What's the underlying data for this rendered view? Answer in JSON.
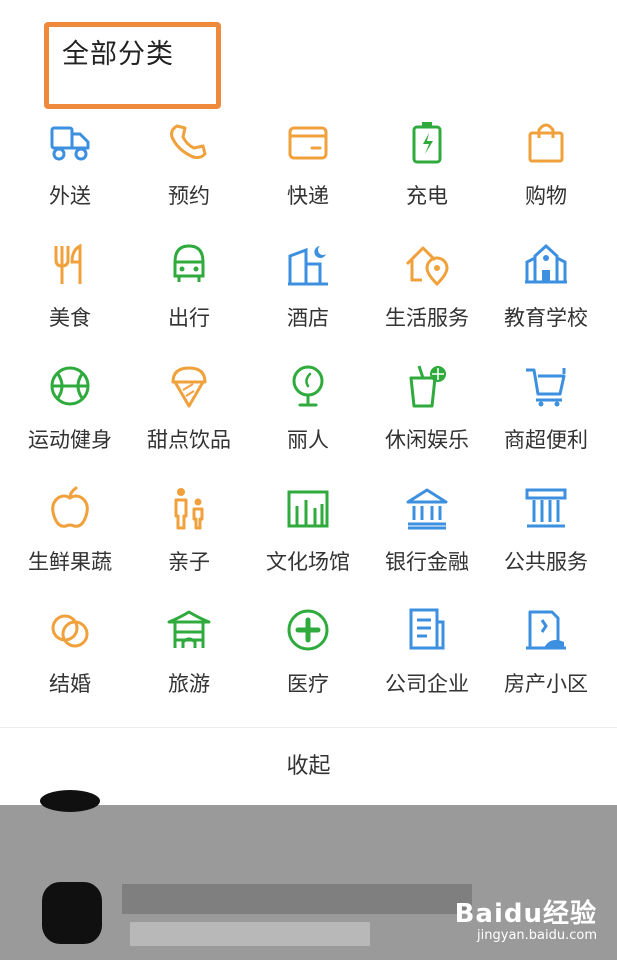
{
  "header": {
    "title": "全部分类"
  },
  "categories": [
    {
      "label": "外送",
      "icon": "truck-icon",
      "color": "#3d8fe0"
    },
    {
      "label": "预约",
      "icon": "phone-icon",
      "color": "#f0a13c"
    },
    {
      "label": "快递",
      "icon": "wallet-icon",
      "color": "#f0a13c"
    },
    {
      "label": "充电",
      "icon": "battery-icon",
      "color": "#2faa3c"
    },
    {
      "label": "购物",
      "icon": "shopping-bag-icon",
      "color": "#f0a13c"
    },
    {
      "label": "美食",
      "icon": "fork-icon",
      "color": "#f0a13c"
    },
    {
      "label": "出行",
      "icon": "bus-icon",
      "color": "#2faa3c"
    },
    {
      "label": "酒店",
      "icon": "hotel-icon",
      "color": "#3d8fe0"
    },
    {
      "label": "生活服务",
      "icon": "home-location-icon",
      "color": "#f0a13c"
    },
    {
      "label": "教育学校",
      "icon": "school-icon",
      "color": "#3d8fe0"
    },
    {
      "label": "运动健身",
      "icon": "ball-icon",
      "color": "#2faa3c"
    },
    {
      "label": "甜点饮品",
      "icon": "ice-cream-icon",
      "color": "#f0a13c"
    },
    {
      "label": "丽人",
      "icon": "mirror-icon",
      "color": "#2faa3c"
    },
    {
      "label": "休闲娱乐",
      "icon": "drink-icon",
      "color": "#2faa3c"
    },
    {
      "label": "商超便利",
      "icon": "cart-icon",
      "color": "#3d8fe0"
    },
    {
      "label": "生鲜果蔬",
      "icon": "apple-icon",
      "color": "#f0a13c"
    },
    {
      "label": "亲子",
      "icon": "parent-child-icon",
      "color": "#f0a13c"
    },
    {
      "label": "文化场馆",
      "icon": "venue-icon",
      "color": "#2faa3c"
    },
    {
      "label": "银行金融",
      "icon": "bank-icon",
      "color": "#3d8fe0"
    },
    {
      "label": "公共服务",
      "icon": "public-building-icon",
      "color": "#3d8fe0"
    },
    {
      "label": "结婚",
      "icon": "rings-icon",
      "color": "#f0a13c"
    },
    {
      "label": "旅游",
      "icon": "pavilion-icon",
      "color": "#2faa3c"
    },
    {
      "label": "医疗",
      "icon": "medical-cross-icon",
      "color": "#2faa3c"
    },
    {
      "label": "公司企业",
      "icon": "office-doc-icon",
      "color": "#3d8fe0"
    },
    {
      "label": "房产小区",
      "icon": "property-icon",
      "color": "#3d8fe0"
    }
  ],
  "footer": {
    "collapse_label": "收起"
  },
  "watermark": {
    "brand": "Baidu经验",
    "url": "jingyan.baidu.com"
  }
}
